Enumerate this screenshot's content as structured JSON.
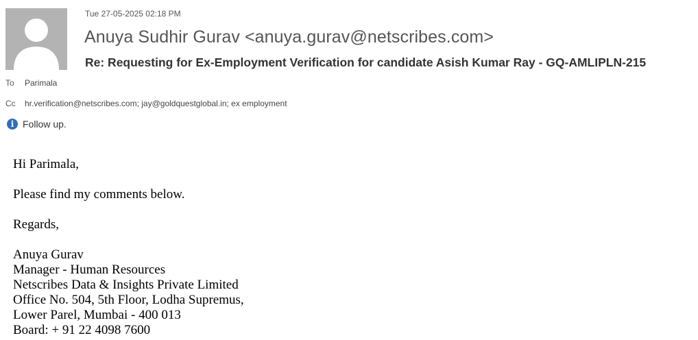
{
  "message": {
    "timestamp": "Tue 27-05-2025 02:18 PM",
    "sender": "Anuya Sudhir Gurav <anuya.gurav@netscribes.com>",
    "subject": "Re: Requesting for Ex-Employment Verification for candidate Asish Kumar Ray - GQ-AMLIPLN-215",
    "to_label": "To",
    "to": "Parimala",
    "cc_label": "Cc",
    "cc": "hr.verification@netscribes.com; jay@goldquestglobal.in; ex employment",
    "followup_icon": "info-icon",
    "followup": "Follow up."
  },
  "body": {
    "greeting": "Hi Parimala,",
    "line1": "Please find my comments below.",
    "closing": "Regards,",
    "signature": {
      "name": "Anuya Gurav",
      "title": "Manager - Human Resources",
      "company": "Netscribes Data & Insights Private Limited",
      "address1": "Office No. 504, 5th Floor, Lodha Supremus,",
      "address2": "Lower Parel, Mumbai - 400 013",
      "phone": "Board: + 91 22 4098 7600"
    }
  },
  "colors": {
    "avatar_bg": "#b3b3b3",
    "info_icon": "#2f6fba"
  }
}
